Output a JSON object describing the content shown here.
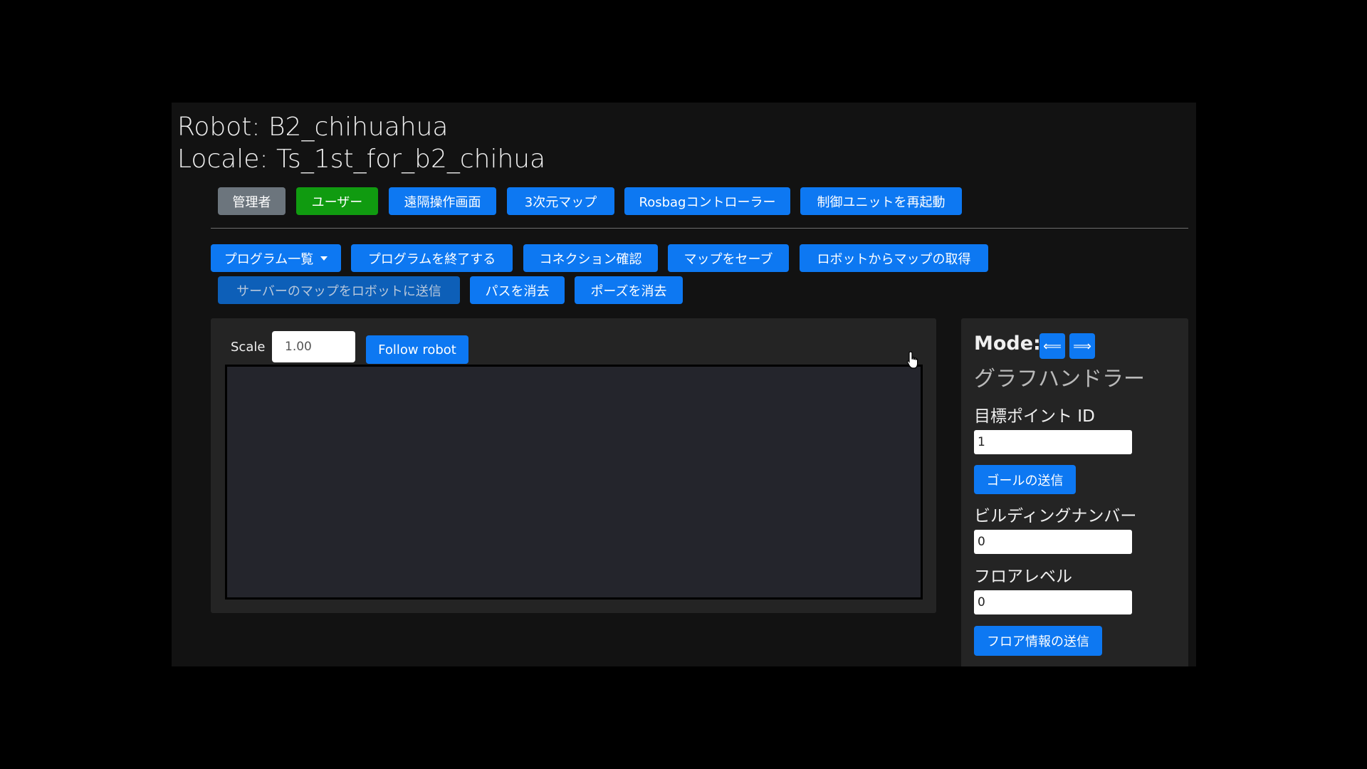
{
  "header": {
    "robot_line": "Robot: B2_chihuahua",
    "locale_line": "Locale: Ts_1st_for_b2_chihua"
  },
  "nav": {
    "admin": "管理者",
    "user": "ユーザー",
    "teleop": "遠隔操作画面",
    "map3d": "3次元マップ",
    "rosbag": "Rosbagコントローラー",
    "restart": "制御ユニットを再起動"
  },
  "toolbar": {
    "program_list": "プログラム一覧",
    "end_program": "プログラムを終了する",
    "check_connection": "コネクション確認",
    "save_map": "マップをセーブ",
    "get_map": "ロボットからマップの取得",
    "send_map": "サーバーのマップをロボットに送信",
    "clear_path": "パスを消去",
    "clear_pose": "ポーズを消去"
  },
  "map_panel": {
    "scale_label": "Scale",
    "scale_value": "1.00",
    "follow_label": "Follow robot"
  },
  "side": {
    "mode_label": "Mode:",
    "mode_prev_glyph": "⟸",
    "mode_next_glyph": "⟹",
    "handler_title": "グラフハンドラー",
    "goal_label": "目標ポイント ID",
    "goal_value": "1",
    "send_goal": "ゴールの送信",
    "building_label": "ビルディングナンバー",
    "building_value": "0",
    "floor_label": "フロアレベル",
    "floor_value": "0",
    "send_floor": "フロア情報の送信"
  },
  "colors": {
    "primary": "#0d78f2",
    "success": "#109b10",
    "secondary": "#6c757d",
    "app_background": "#121212",
    "panel_background": "#242424"
  }
}
